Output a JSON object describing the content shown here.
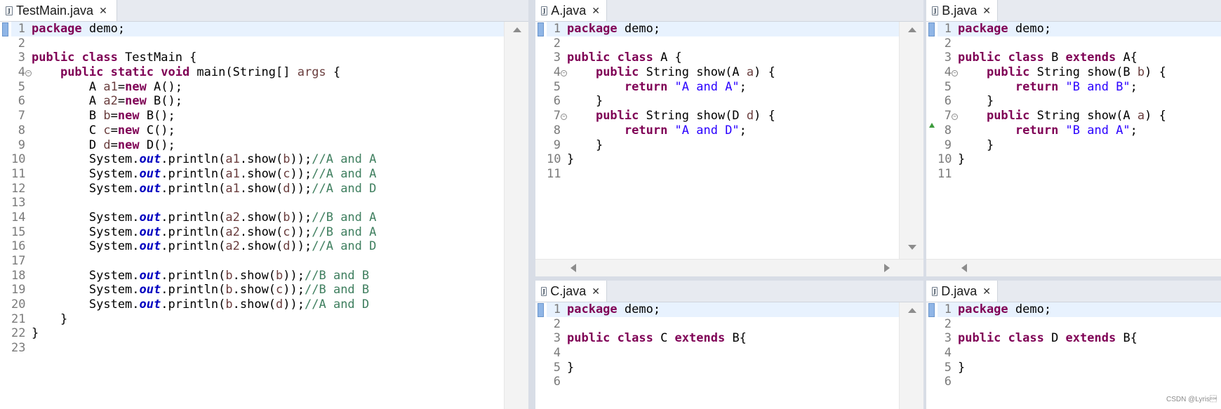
{
  "editors": [
    {
      "id": "testmain",
      "tab": "TestMain.java",
      "lines": [
        [
          [
            "kw",
            "package"
          ],
          [
            "",
            "demo;"
          ]
        ],
        [],
        [
          [
            "kw",
            "public class"
          ],
          [
            "",
            "TestMain {"
          ]
        ],
        [
          [
            "",
            "    "
          ],
          [
            "kw",
            "public static void"
          ],
          [
            "",
            " main(String[] "
          ],
          [
            "var",
            "args"
          ],
          [
            "",
            " {"
          ]
        ],
        [
          [
            "",
            "        A "
          ],
          [
            "var",
            "a1"
          ],
          [
            "",
            "="
          ],
          [
            "kw",
            "new"
          ],
          [
            "",
            " A();"
          ]
        ],
        [
          [
            "",
            "        A "
          ],
          [
            "var",
            "a2"
          ],
          [
            "",
            "="
          ],
          [
            "kw",
            "new"
          ],
          [
            "",
            " B();"
          ]
        ],
        [
          [
            "",
            "        B "
          ],
          [
            "var",
            "b"
          ],
          [
            "",
            "="
          ],
          [
            "kw",
            "new"
          ],
          [
            "",
            " B();"
          ]
        ],
        [
          [
            "",
            "        C "
          ],
          [
            "var",
            "c"
          ],
          [
            "",
            "="
          ],
          [
            "kw",
            "new"
          ],
          [
            "",
            " C();"
          ]
        ],
        [
          [
            "",
            "        D "
          ],
          [
            "var",
            "d"
          ],
          [
            "",
            "="
          ],
          [
            "kw",
            "new"
          ],
          [
            "",
            " D();"
          ]
        ],
        [
          [
            "",
            "        System."
          ],
          [
            "fld",
            "out"
          ],
          [
            "",
            ".println("
          ],
          [
            "var",
            "a1"
          ],
          [
            "",
            ".show("
          ],
          [
            "var",
            "b"
          ],
          [
            "",
            "));"
          ],
          [
            "cm",
            "//A and A"
          ]
        ],
        [
          [
            "",
            "        System."
          ],
          [
            "fld",
            "out"
          ],
          [
            "",
            ".println("
          ],
          [
            "var",
            "a1"
          ],
          [
            "",
            ".show("
          ],
          [
            "var",
            "c"
          ],
          [
            "",
            "));"
          ],
          [
            "cm",
            "//A and A"
          ]
        ],
        [
          [
            "",
            "        System."
          ],
          [
            "fld",
            "out"
          ],
          [
            "",
            ".println("
          ],
          [
            "var",
            "a1"
          ],
          [
            "",
            ".show("
          ],
          [
            "var",
            "d"
          ],
          [
            "",
            "));"
          ],
          [
            "cm",
            "//A and D"
          ]
        ],
        [],
        [
          [
            "",
            "        System."
          ],
          [
            "fld",
            "out"
          ],
          [
            "",
            ".println("
          ],
          [
            "var",
            "a2"
          ],
          [
            "",
            ".show("
          ],
          [
            "var",
            "b"
          ],
          [
            "",
            "));"
          ],
          [
            "cm",
            "//B and A"
          ]
        ],
        [
          [
            "",
            "        System."
          ],
          [
            "fld",
            "out"
          ],
          [
            "",
            ".println("
          ],
          [
            "var",
            "a2"
          ],
          [
            "",
            ".show("
          ],
          [
            "var",
            "c"
          ],
          [
            "",
            "));"
          ],
          [
            "cm",
            "//B and A"
          ]
        ],
        [
          [
            "",
            "        System."
          ],
          [
            "fld",
            "out"
          ],
          [
            "",
            ".println("
          ],
          [
            "var",
            "a2"
          ],
          [
            "",
            ".show("
          ],
          [
            "var",
            "d"
          ],
          [
            "",
            "));"
          ],
          [
            "cm",
            "//A and D"
          ]
        ],
        [],
        [
          [
            "",
            "        System."
          ],
          [
            "fld",
            "out"
          ],
          [
            "",
            ".println("
          ],
          [
            "var",
            "b"
          ],
          [
            "",
            ".show("
          ],
          [
            "var",
            "b"
          ],
          [
            "",
            "));"
          ],
          [
            "cm",
            "//B and B"
          ]
        ],
        [
          [
            "",
            "        System."
          ],
          [
            "fld",
            "out"
          ],
          [
            "",
            ".println("
          ],
          [
            "var",
            "b"
          ],
          [
            "",
            ".show("
          ],
          [
            "var",
            "c"
          ],
          [
            "",
            "));"
          ],
          [
            "cm",
            "//B and B"
          ]
        ],
        [
          [
            "",
            "        System."
          ],
          [
            "fld",
            "out"
          ],
          [
            "",
            ".println("
          ],
          [
            "var",
            "b"
          ],
          [
            "",
            ".show("
          ],
          [
            "var",
            "d"
          ],
          [
            "",
            "));"
          ],
          [
            "cm",
            "//A and D"
          ]
        ],
        [
          [
            "",
            "    }"
          ]
        ],
        [
          [
            "",
            "}"
          ]
        ],
        []
      ]
    },
    {
      "id": "a",
      "tab": "A.java",
      "lines": [
        [
          [
            "kw",
            "package"
          ],
          [
            "",
            "demo;"
          ]
        ],
        [],
        [
          [
            "kw",
            "public class"
          ],
          [
            "",
            " A {"
          ]
        ],
        [
          [
            "",
            "    "
          ],
          [
            "kw",
            "public"
          ],
          [
            "",
            " String show(A "
          ],
          [
            "var",
            "a"
          ],
          [
            "",
            ") {"
          ]
        ],
        [
          [
            "",
            "        "
          ],
          [
            "kw",
            "return"
          ],
          [
            "",
            ""
          ],
          [
            "str",
            "\"A and A\""
          ],
          [
            "",
            ";"
          ]
        ],
        [
          [
            "",
            "    }"
          ]
        ],
        [
          [
            "",
            "    "
          ],
          [
            "kw",
            "public"
          ],
          [
            "",
            " String show(D "
          ],
          [
            "var",
            "d"
          ],
          [
            "",
            ") {"
          ]
        ],
        [
          [
            "",
            "        "
          ],
          [
            "kw",
            "return"
          ],
          [
            "",
            ""
          ],
          [
            "str",
            "\"A and D\""
          ],
          [
            "",
            ";"
          ]
        ],
        [
          [
            "",
            "    }"
          ]
        ],
        [
          [
            "",
            "}"
          ]
        ],
        []
      ]
    },
    {
      "id": "b",
      "tab": "B.java",
      "lines": [
        [
          [
            "kw",
            "package"
          ],
          [
            "",
            "demo;"
          ]
        ],
        [],
        [
          [
            "kw",
            "public class"
          ],
          [
            "",
            " B "
          ],
          [
            "kw",
            "extends"
          ],
          [
            "",
            " A{"
          ]
        ],
        [
          [
            "",
            "    "
          ],
          [
            "kw",
            "public"
          ],
          [
            "",
            " String show(B "
          ],
          [
            "var",
            "b"
          ],
          [
            "",
            ") {"
          ]
        ],
        [
          [
            "",
            "        "
          ],
          [
            "kw",
            "return"
          ],
          [
            "",
            ""
          ],
          [
            "str",
            "\"B and B\""
          ],
          [
            "",
            ";"
          ]
        ],
        [
          [
            "",
            "    }"
          ]
        ],
        [
          [
            "",
            "    "
          ],
          [
            "kw",
            "public"
          ],
          [
            "",
            " String show(A "
          ],
          [
            "var",
            "a"
          ],
          [
            "",
            ") {"
          ]
        ],
        [
          [
            "",
            "        "
          ],
          [
            "kw",
            "return"
          ],
          [
            "",
            ""
          ],
          [
            "str",
            "\"B and A\""
          ],
          [
            "",
            ";"
          ]
        ],
        [
          [
            "",
            "    }"
          ]
        ],
        [
          [
            "",
            "}"
          ]
        ],
        []
      ]
    },
    {
      "id": "c",
      "tab": "C.java",
      "lines": [
        [
          [
            "kw",
            "package"
          ],
          [
            "",
            "demo;"
          ]
        ],
        [],
        [
          [
            "kw",
            "public class"
          ],
          [
            "",
            " C "
          ],
          [
            "kw",
            "extends"
          ],
          [
            "",
            " B{"
          ]
        ],
        [],
        [
          [
            "",
            "}"
          ]
        ],
        []
      ]
    },
    {
      "id": "d",
      "tab": "D.java",
      "lines": [
        [
          [
            "kw",
            "package"
          ],
          [
            "",
            "demo;"
          ]
        ],
        [],
        [
          [
            "kw",
            "public class"
          ],
          [
            "",
            " D "
          ],
          [
            "kw",
            "extends"
          ],
          [
            "",
            " B{"
          ]
        ],
        [],
        [
          [
            "",
            "}"
          ]
        ],
        []
      ]
    }
  ],
  "watermark": "CSDN @Lyris\u0001"
}
